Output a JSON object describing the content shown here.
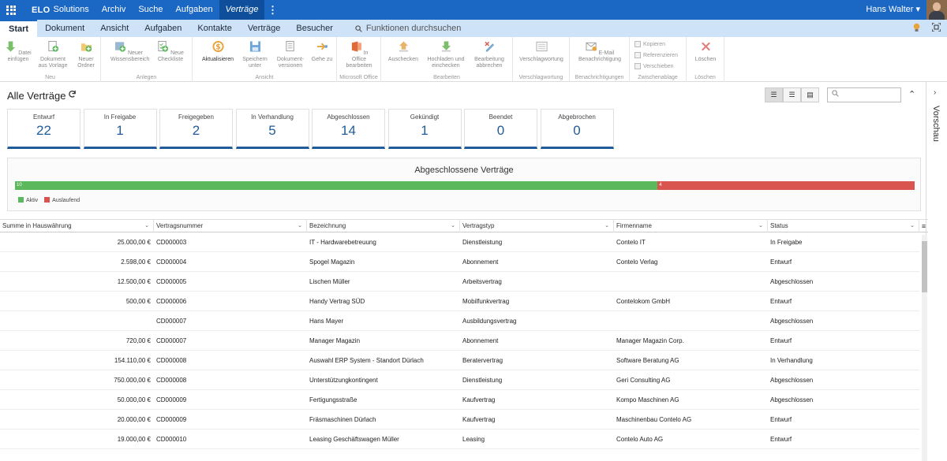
{
  "app": {
    "logo": "ELO",
    "product": "Solutions"
  },
  "top_nav": [
    "Archiv",
    "Suche",
    "Aufgaben",
    "Verträge"
  ],
  "top_nav_active": "Verträge",
  "user": {
    "name": "Hans Walter ▾"
  },
  "ribbon_tabs": [
    "Start",
    "Dokument",
    "Ansicht",
    "Aufgaben",
    "Kontakte",
    "Verträge",
    "Besucher"
  ],
  "ribbon_tab_active": "Start",
  "function_search": "Funktionen durchsuchen",
  "ribbon": {
    "btn_datei_einfuegen": "Datei einfügen",
    "btn_dokument_vorlage": "Dokument aus Vorlage",
    "btn_neuer_ordner": "Neuer Ordner",
    "grp_neu": "Neu",
    "btn_wissensbereich": "Neuer Wissensbereich",
    "btn_checkliste": "Neue Checkliste",
    "grp_anlegen": "Anlegen",
    "btn_aktualisieren": "Aktualisieren",
    "btn_speichern": "Speichern unter",
    "btn_dokumentversionen": "Dokument-versionen",
    "btn_gehe_zu": "Gehe zu",
    "grp_ansicht": "Ansicht",
    "btn_office": "In Office bearbeiten",
    "grp_office": "Microsoft Office",
    "btn_auschecken": "Auschecken",
    "btn_hochladen": "Hochladen und einchecken",
    "btn_abbrechen": "Bearbeitung abbrechen",
    "grp_bearbeiten": "Bearbeiten",
    "btn_verschlagwortung": "Verschlagwortung",
    "grp_verschlagwortung": "Verschlagwortung",
    "btn_email": "E-Mail Benachrichtigung",
    "grp_benachrichtigungen": "Benachrichtigungen",
    "btn_kopieren": "Kopieren",
    "btn_referenzieren": "Referenzieren",
    "btn_verschieben": "Verschieben",
    "grp_zwischenablage": "Zwischenablage",
    "btn_loeschen": "Löschen",
    "grp_loeschen": "Löschen"
  },
  "page_title": "Alle Verträge",
  "search_placeholder": "",
  "side_panel_label": "Vorschau",
  "tiles": [
    {
      "label": "Entwurf",
      "value": "22"
    },
    {
      "label": "In Freigabe",
      "value": "1"
    },
    {
      "label": "Freigegeben",
      "value": "2"
    },
    {
      "label": "In Verhandlung",
      "value": "5"
    },
    {
      "label": "Abgeschlossen",
      "value": "14"
    },
    {
      "label": "Gekündigt",
      "value": "1"
    },
    {
      "label": "Beendet",
      "value": "0"
    },
    {
      "label": "Abgebrochen",
      "value": "0"
    }
  ],
  "chart_data": {
    "type": "bar",
    "title": "Abgeschlossene Verträge",
    "stacked": true,
    "orientation": "horizontal",
    "series": [
      {
        "name": "Aktiv",
        "values": [
          10
        ],
        "color": "#5cb85c"
      },
      {
        "name": "Auslaufend",
        "values": [
          4
        ],
        "color": "#d9534f"
      }
    ],
    "legend": "bottom-left"
  },
  "table": {
    "columns": [
      "Summe in Hauswährung",
      "Vertragsnummer",
      "Bezeichnung",
      "Vertragstyp",
      "Firmenname",
      "Status"
    ],
    "rows": [
      [
        "25.000,00 €",
        "CD000003",
        "IT - Hardwarebetreuung",
        "Dienstleistung",
        "Contelo IT",
        "In Freigabe"
      ],
      [
        "2.598,00 €",
        "CD000004",
        "Spogel Magazin",
        "Abonnement",
        "Contelo Verlag",
        "Entwurf"
      ],
      [
        "12.500,00 €",
        "CD000005",
        "Lischen Müller",
        "Arbeitsvertrag",
        "",
        "Abgeschlossen"
      ],
      [
        "500,00 €",
        "CD000006",
        "Handy Vertrag SÜD",
        "Mobilfunkvertrag",
        "Contelokom GmbH",
        "Entwurf"
      ],
      [
        "",
        "CD000007",
        "Hans Mayer",
        "Ausbildungsvertrag",
        "",
        "Abgeschlossen"
      ],
      [
        "720,00 €",
        "CD000007",
        "Manager Magazin",
        "Abonnement",
        "Manager Magazin Corp.",
        "Entwurf"
      ],
      [
        "154.110,00 €",
        "CD000008",
        "Auswahl ERP System - Standort Dürlach",
        "Beratervertrag",
        "Software Beratung AG",
        "In Verhandlung"
      ],
      [
        "750.000,00 €",
        "CD000008",
        "Unterstützungkontingent",
        "Dienstleistung",
        "Geri Consulting AG",
        "Abgeschlossen"
      ],
      [
        "50.000,00 €",
        "CD000009",
        "Fertigungsstraße",
        "Kaufvertrag",
        "Kompo Maschinen AG",
        "Abgeschlossen"
      ],
      [
        "20.000,00 €",
        "CD000009",
        "Fräsmaschinen Dürlach",
        "Kaufvertrag",
        "Maschinenbau Contelo AG",
        "Entwurf"
      ],
      [
        "19.000,00 €",
        "CD000010",
        "Leasing Geschäftswagen Müller",
        "Leasing",
        "Contelo Auto AG",
        "Entwurf"
      ]
    ]
  }
}
